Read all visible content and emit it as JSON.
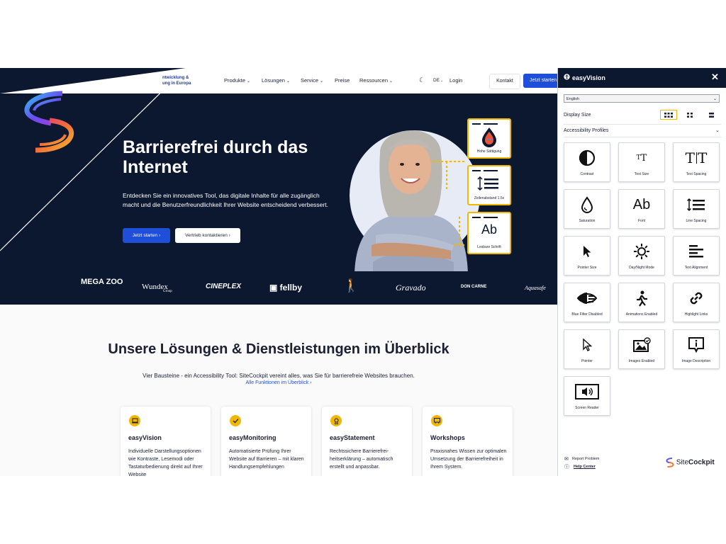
{
  "header": {
    "tagline": "...ntwicklung & ...ung in Europa",
    "tagline_line1": "ntwicklung &",
    "tagline_line2": "ung in Europa",
    "nav": [
      "Produkte",
      "Lösungen",
      "Service",
      "Preise",
      "Ressourcen"
    ],
    "lang": "DE",
    "login": "Login",
    "kontakt": "Kontakt",
    "start": "Jetzt starten"
  },
  "hero": {
    "title": "Barrierefrei durch das Internet",
    "text": "Entdecken Sie ein innovatives Tool, das digitale Inhalte für alle zu­gänglich macht und die Benutzerfreundlichkeit Ihrer Website ent­scheidend verbessert.",
    "btn_primary": "Jetzt starten",
    "btn_secondary": "Vertrieb kontaktieren",
    "cards": [
      "Hohe Sättigung",
      "Zeilenabstand 1.5x",
      "Lesbare Schrift"
    ],
    "card_ab": "Ab"
  },
  "brands": [
    "MEGA ZOO",
    "Wundex",
    "CINEPLEX",
    "fellby",
    "",
    "Gravado",
    "DON CARNE",
    "Aquasafe"
  ],
  "brands_sub": {
    "wundex": "Group"
  },
  "section": {
    "title": "Unsere Lösungen & Dienstleistungen im Überblick",
    "subtitle": "Vier Bausteine - ein Accessibility Tool: SiteCockpit vereint alles, was Sie für barrierefreie Websites brauchen.",
    "link": "Alle Funktionen im Überblick"
  },
  "cards": [
    {
      "title": "easyVision",
      "text": "Individuelle Darstellungsoptio­nen wie Kontraste, Lesemodi oder Tastaturbedienung direkt auf Ihrer Website"
    },
    {
      "title": "easyMonitoring",
      "text": "Automatisierte Prüfung Ihrer Website auf Barrieren – mit klaren Handlungsempfehlun­gen"
    },
    {
      "title": "easyStatement",
      "text": "Rechtssichere Barrierefrei­heitserklärung – automatisch erstellt und anpassbar."
    },
    {
      "title": "Workshops",
      "text": "Praxisnahes Wissen zur opti­malen Umsetzung der Barrie­refreiheit in Ihrem System."
    }
  ],
  "widget": {
    "title": "easyVision",
    "language": "English",
    "display_size": "Display Size",
    "profiles": "Accessibility Profiles",
    "tiles": [
      {
        "label": "Contrast",
        "icon": "contrast-icon"
      },
      {
        "label": "Text Size",
        "icon": "text-size-icon"
      },
      {
        "label": "Text Spacing",
        "icon": "text-spacing-icon"
      },
      {
        "label": "Saturation",
        "icon": "saturation-icon"
      },
      {
        "label": "Font",
        "icon": "font-icon"
      },
      {
        "label": "Line Spacing",
        "icon": "line-spacing-icon"
      },
      {
        "label": "Pointer Size",
        "icon": "pointer-size-icon"
      },
      {
        "label": "Day/Night Mode",
        "icon": "day-night-icon"
      },
      {
        "label": "Text Alignment",
        "icon": "text-alignment-icon"
      },
      {
        "label": "Blue Filter Disabled",
        "icon": "blue-filter-icon"
      },
      {
        "label": "Animations Enabled",
        "icon": "animations-icon"
      },
      {
        "label": "Highlight Links",
        "icon": "highlight-links-icon"
      },
      {
        "label": "Pointer",
        "icon": "pointer-icon"
      },
      {
        "label": "Images Enabled",
        "icon": "images-icon"
      },
      {
        "label": "Image Description",
        "icon": "image-description-icon"
      },
      {
        "label": "Screen Reader",
        "icon": "screen-reader-icon"
      }
    ],
    "font_glyph": "Ab",
    "report": "Report Problem",
    "help": "Help Center",
    "brand_a": "Site",
    "brand_b": "Cockpit"
  },
  "colors": {
    "navy": "#0c1730",
    "blue": "#1f4fd9",
    "yellow": "#f2b705"
  }
}
